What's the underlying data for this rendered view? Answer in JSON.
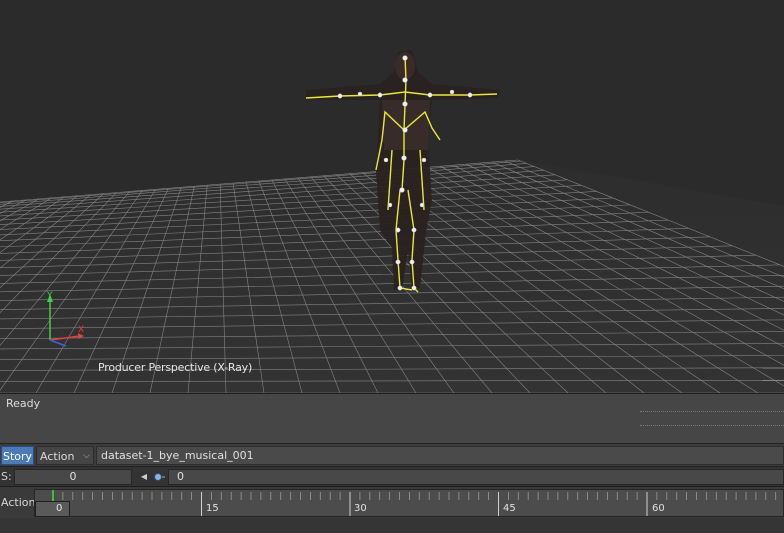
{
  "viewport": {
    "label": "Producer Perspective (X-Ray)",
    "axis_x": "X",
    "axis_y": "Y"
  },
  "status": {
    "text": "Ready"
  },
  "navigator": {
    "tab_story": "Story",
    "tab_action": "Action",
    "take_name": "dataset-1_bye_musical_001"
  },
  "controls": {
    "s_label": "S:",
    "s_value": "0",
    "key_value": "0"
  },
  "timeline": {
    "label": "Action",
    "current_frame": "0",
    "ticks": [
      "15",
      "30",
      "45",
      "60"
    ]
  }
}
